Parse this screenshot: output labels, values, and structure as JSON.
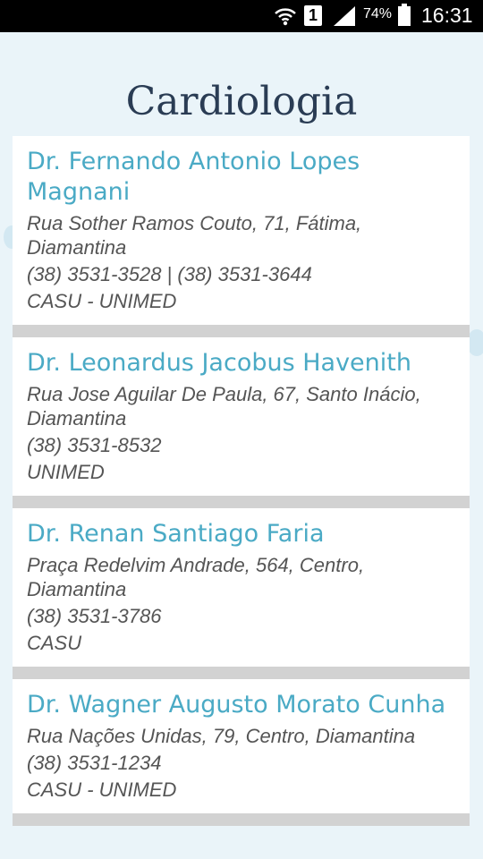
{
  "status_bar": {
    "sim_slot": "1",
    "battery_percent": "74%",
    "time": "16:31",
    "icons": [
      "wifi-icon",
      "sim-icon",
      "signal-icon",
      "battery-icon"
    ]
  },
  "page": {
    "title": "Cardiologia"
  },
  "doctors": [
    {
      "name": "Dr. Fernando Antonio Lopes Magnani",
      "address": "Rua Sother Ramos Couto, 71, Fátima, Diamantina",
      "phone": "(38) 3531-3528 | (38) 3531-3644",
      "insurance": "CASU - UNIMED"
    },
    {
      "name": "Dr. Leonardus Jacobus Havenith",
      "address": "Rua Jose Aguilar De Paula, 67, Santo Inácio, Diamantina",
      "phone": "(38) 3531-8532",
      "insurance": "UNIMED"
    },
    {
      "name": "Dr. Renan Santiago Faria",
      "address": "Praça Redelvim Andrade, 564, Centro, Diamantina",
      "phone": "(38) 3531-3786",
      "insurance": "CASU"
    },
    {
      "name": "Dr. Wagner Augusto Morato Cunha",
      "address": "Rua Nações Unidas, 79, Centro, Diamantina",
      "phone": "(38) 3531-1234",
      "insurance": "CASU - UNIMED"
    }
  ],
  "colors": {
    "background": "#eaf4f9",
    "title": "#2a3c54",
    "doctor_name": "#4aaac5",
    "detail_text": "#555555",
    "separator": "#d2d2d2"
  }
}
